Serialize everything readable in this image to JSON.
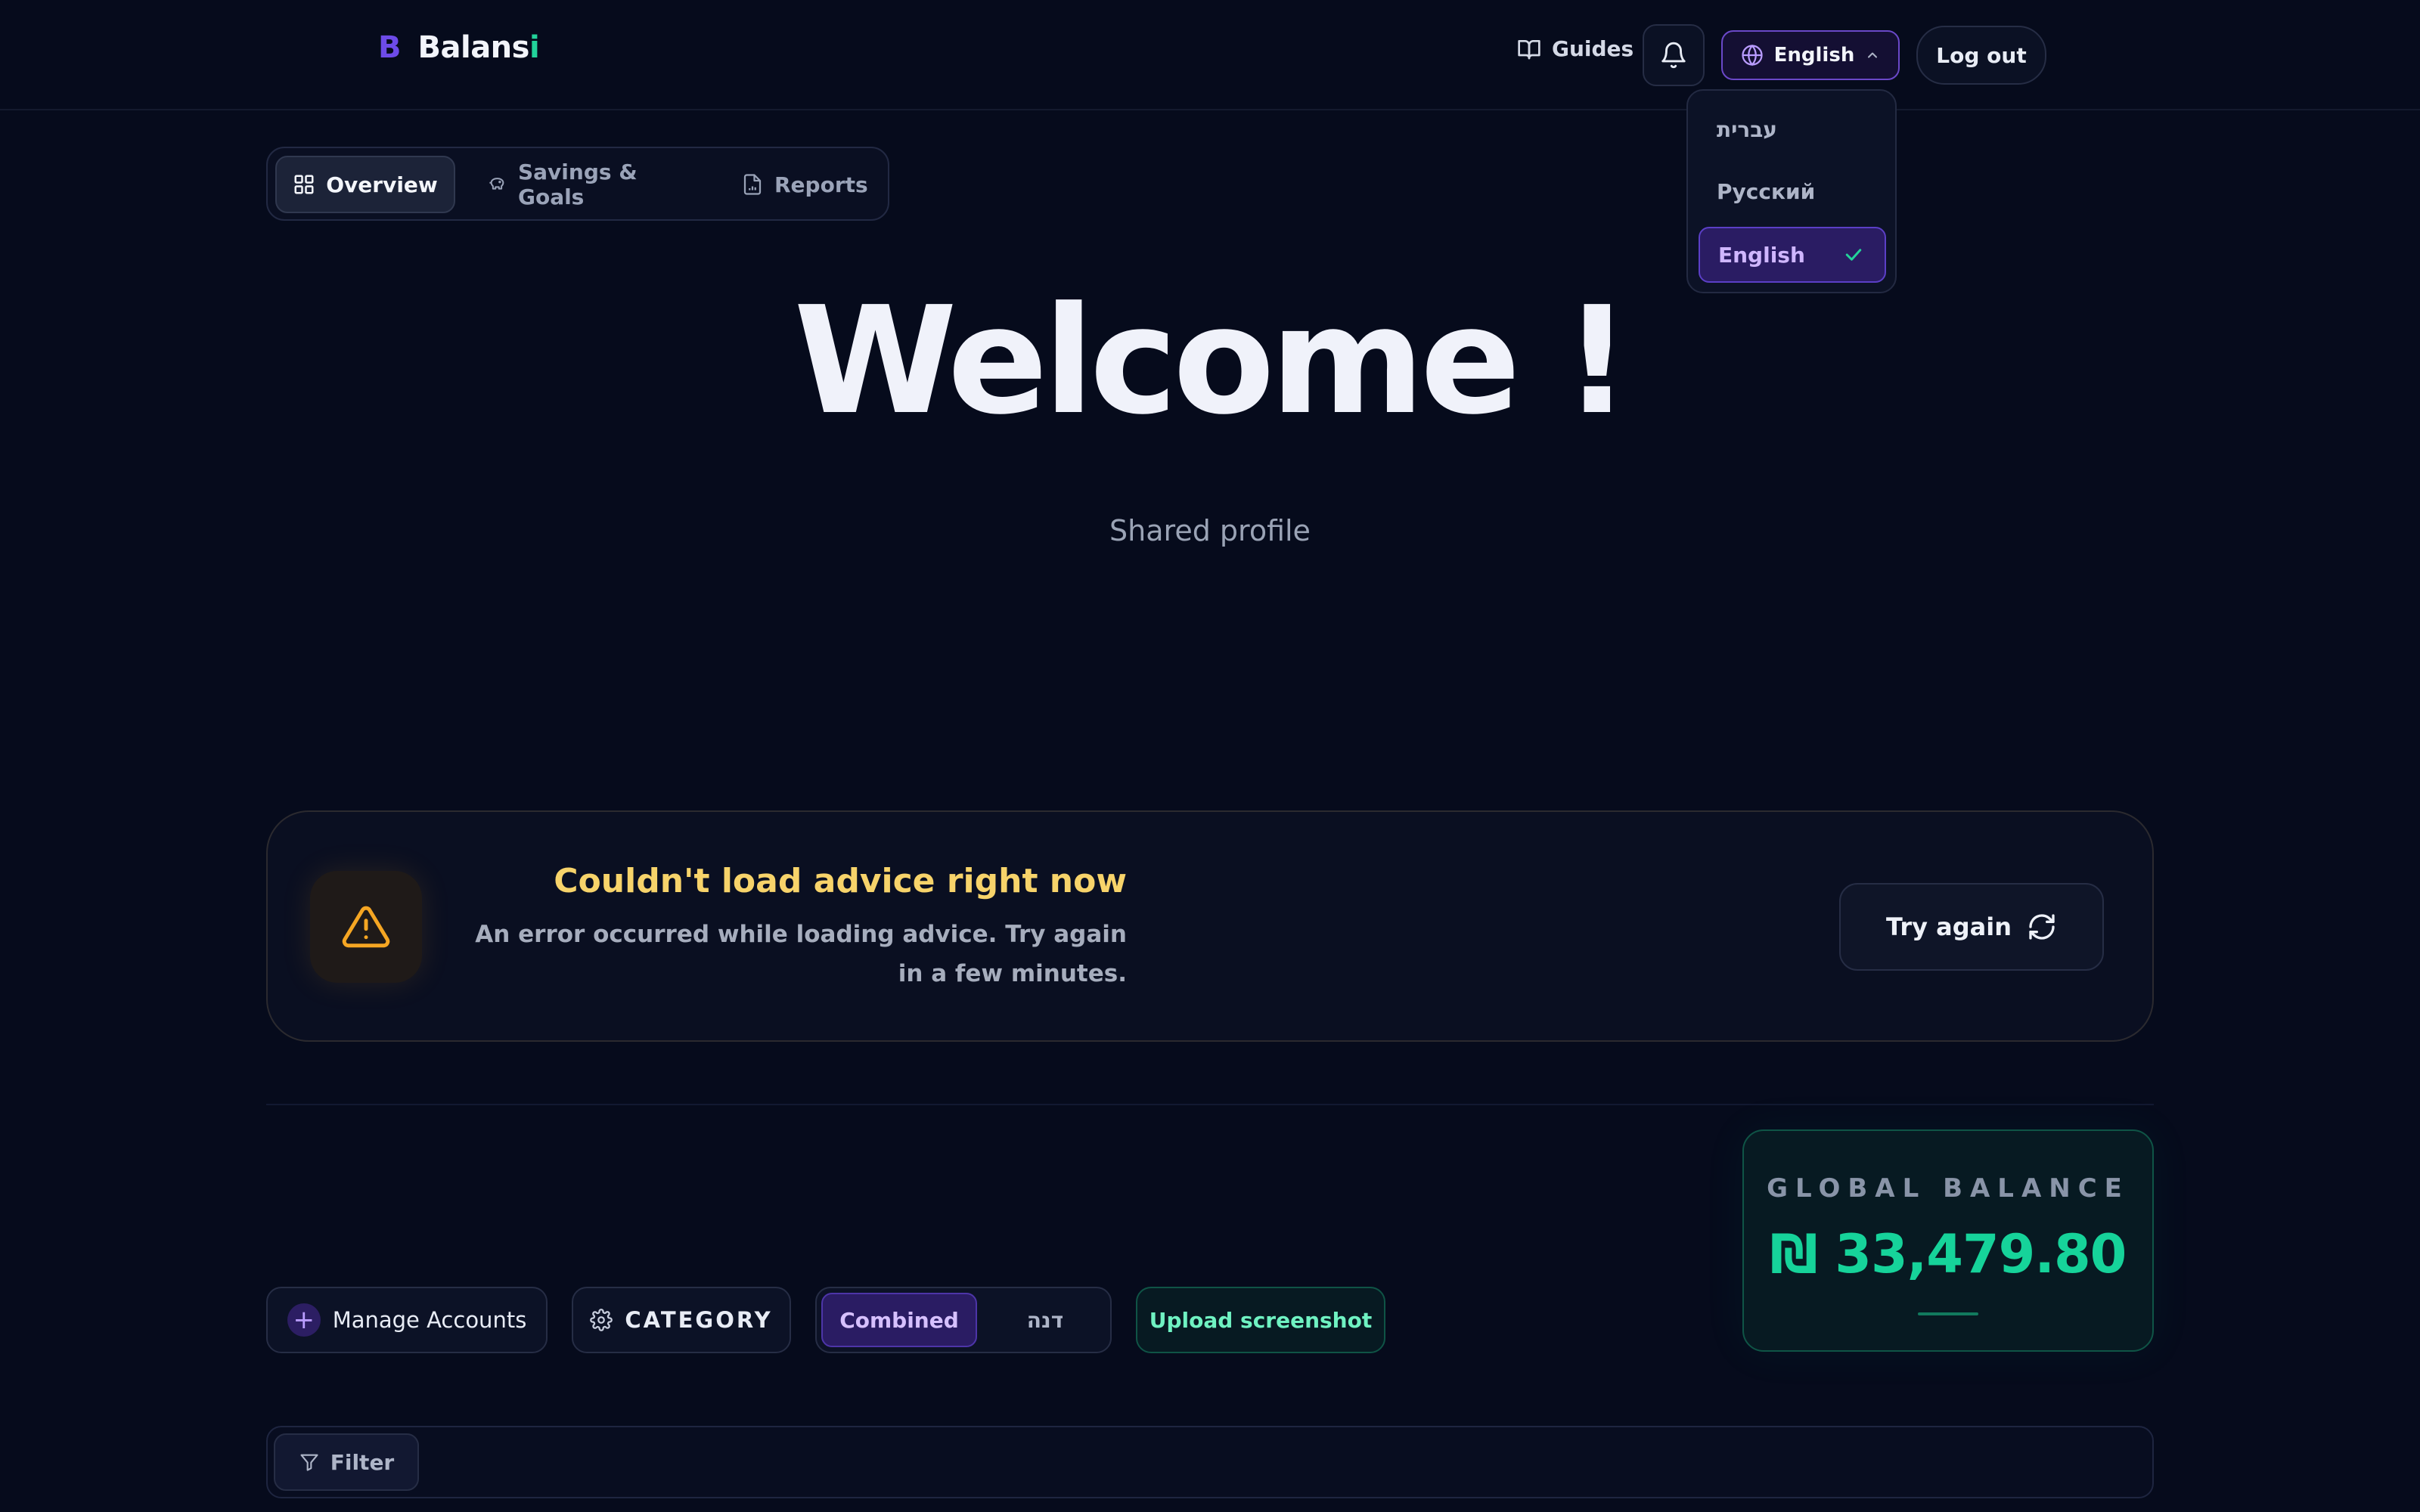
{
  "header": {
    "logo_mark": "B",
    "logo_text_main": "Balans",
    "logo_text_accent": "i",
    "guides_label": "Guides",
    "notifications_icon": "bell-icon",
    "language_current": "English",
    "logout_label": "Log out"
  },
  "language_menu": {
    "items": [
      {
        "label": "עברית",
        "selected": false
      },
      {
        "label": "Русский",
        "selected": false
      },
      {
        "label": "English",
        "selected": true
      }
    ]
  },
  "tabs": [
    {
      "label": "Overview",
      "icon": "grid-icon",
      "active": true
    },
    {
      "label": "Savings & Goals",
      "icon": "piggy-bank-icon",
      "active": false
    },
    {
      "label": "Reports",
      "icon": "file-chart-icon",
      "active": false
    }
  ],
  "hero": {
    "title": "Welcome !",
    "subtitle": "Shared profile"
  },
  "advice": {
    "title": "Couldn't load advice right now",
    "message": "An error occurred while loading advice. Try again in a few minutes.",
    "retry_label": "Try again",
    "icon": "warning-triangle-icon"
  },
  "balance": {
    "label": "GLOBAL BALANCE",
    "value": "₪ 33,479.80"
  },
  "controls": {
    "manage_accounts_label": "Manage Accounts",
    "category_label": "CATEGORY",
    "view_toggle": {
      "active": "Combined",
      "inactive": "דנה"
    },
    "upload_label": "Upload screenshot"
  },
  "filter": {
    "label": "Filter"
  },
  "colors": {
    "background": "#060b1c",
    "accent_purple": "#6a48c8",
    "accent_green": "#16d39a",
    "warning": "#f7d36a"
  }
}
